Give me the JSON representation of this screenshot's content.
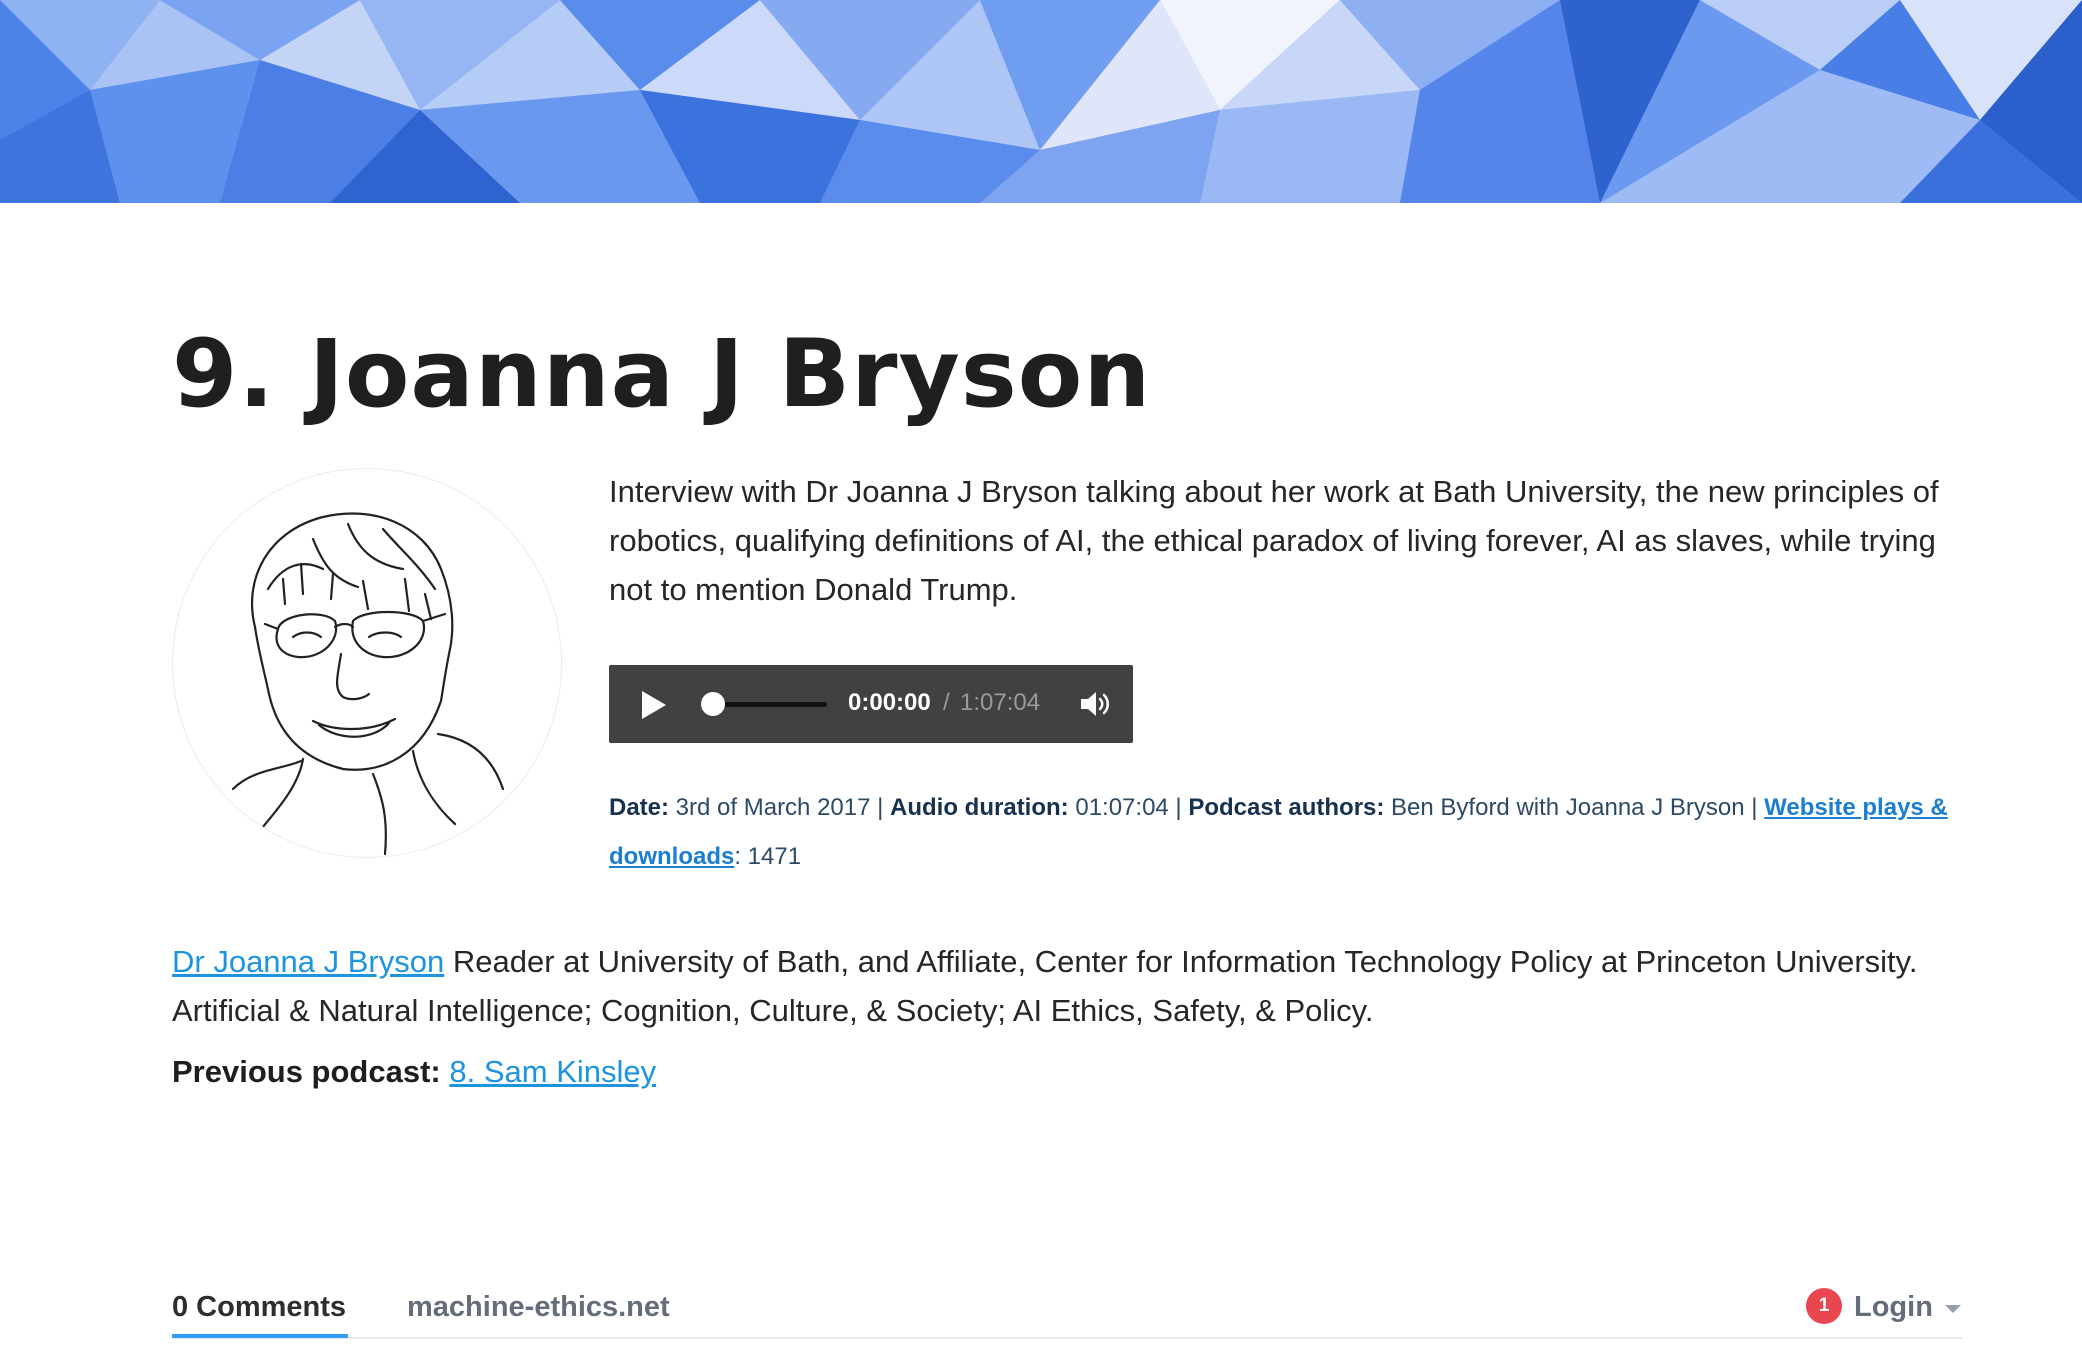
{
  "page": {
    "title": "9. Joanna J Bryson",
    "summary": "Interview with Dr Joanna J Bryson talking about her work at Bath University, the new principles of robotics, qualifying definitions of AI, the ethical paradox of living forever, AI as slaves, while trying not to mention Donald Trump."
  },
  "player": {
    "current_time": "0:00:00",
    "separator": "/",
    "total_time": "1:07:04",
    "progress": 0,
    "play_icon": "play-icon",
    "volume_icon": "volume-icon"
  },
  "meta": {
    "date_label": "Date:",
    "date_value": " 3rd of March 2017 | ",
    "duration_label": "Audio duration:",
    "duration_value": " 01:07:04 | ",
    "authors_label": "Podcast authors:",
    "authors_value": " Ben Byford with Joanna J Bryson | ",
    "plays_link": "Website plays & downloads",
    "plays_value": ": 1471"
  },
  "bio": {
    "link_text": "Dr Joanna J Bryson",
    "text": " Reader at University of Bath, and Affiliate, Center for Information Technology Policy at Princeton University. Artificial & Natural Intelligence; Cognition, Culture, & Society; AI Ethics, Safety, & Policy."
  },
  "previous": {
    "label": "Previous podcast:",
    "link_text": "8. Sam Kinsley"
  },
  "comments": {
    "count_tab": "0 Comments",
    "site_tab": "machine-ethics.net",
    "notification_count": "1",
    "login_label": "Login"
  },
  "colors": {
    "link": "#1c94e0",
    "player_bg": "#414141",
    "tab_underline": "#2e9fff",
    "notification": "#e8474f"
  }
}
